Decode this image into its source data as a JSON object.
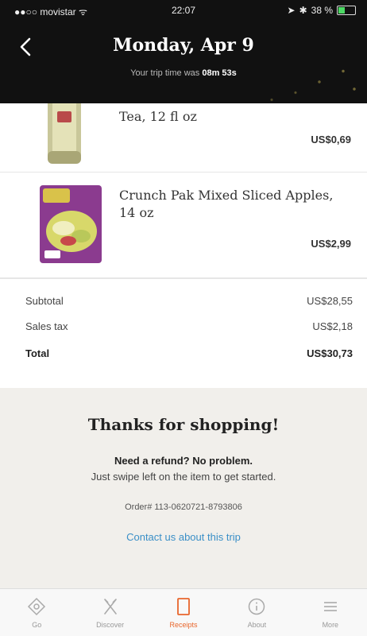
{
  "status_bar": {
    "carrier": "movistar",
    "time": "22:07",
    "battery": "38 %",
    "battery_level": 0.38
  },
  "header": {
    "title": "Monday, Apr 9",
    "trip_time_prefix": "Your trip time was",
    "trip_time_value": "08m 53s"
  },
  "items": [
    {
      "name": "Tea, 12 fl oz",
      "price": "US$0,69",
      "image": "tea-bottle-image"
    },
    {
      "name": "Crunch Pak Mixed Sliced Apples, 14 oz",
      "price": "US$2,99",
      "image": "sliced-apples-bag-image"
    }
  ],
  "totals": {
    "subtotal_label": "Subtotal",
    "subtotal_value": "US$28,55",
    "tax_label": "Sales tax",
    "tax_value": "US$2,18",
    "total_label": "Total",
    "total_value": "US$30,73"
  },
  "thanks": {
    "title": "Thanks for shopping!",
    "refund_title": "Need a refund? No problem.",
    "refund_text": "Just swipe left on the item to get started.",
    "order_number": "Order# 113-0620721-8793806",
    "contact_link": "Contact us about this trip"
  },
  "tabs": [
    {
      "label": "Go",
      "icon": "diamond-icon",
      "active": false
    },
    {
      "label": "Discover",
      "icon": "utensils-icon",
      "active": false
    },
    {
      "label": "Receipts",
      "icon": "receipt-icon",
      "active": true
    },
    {
      "label": "About",
      "icon": "info-icon",
      "active": false
    },
    {
      "label": "More",
      "icon": "menu-icon",
      "active": false
    }
  ],
  "colors": {
    "accent": "#e8662c",
    "link": "#3a8fc7",
    "header_bg": "#111111",
    "thanks_bg": "#f1efeb"
  }
}
